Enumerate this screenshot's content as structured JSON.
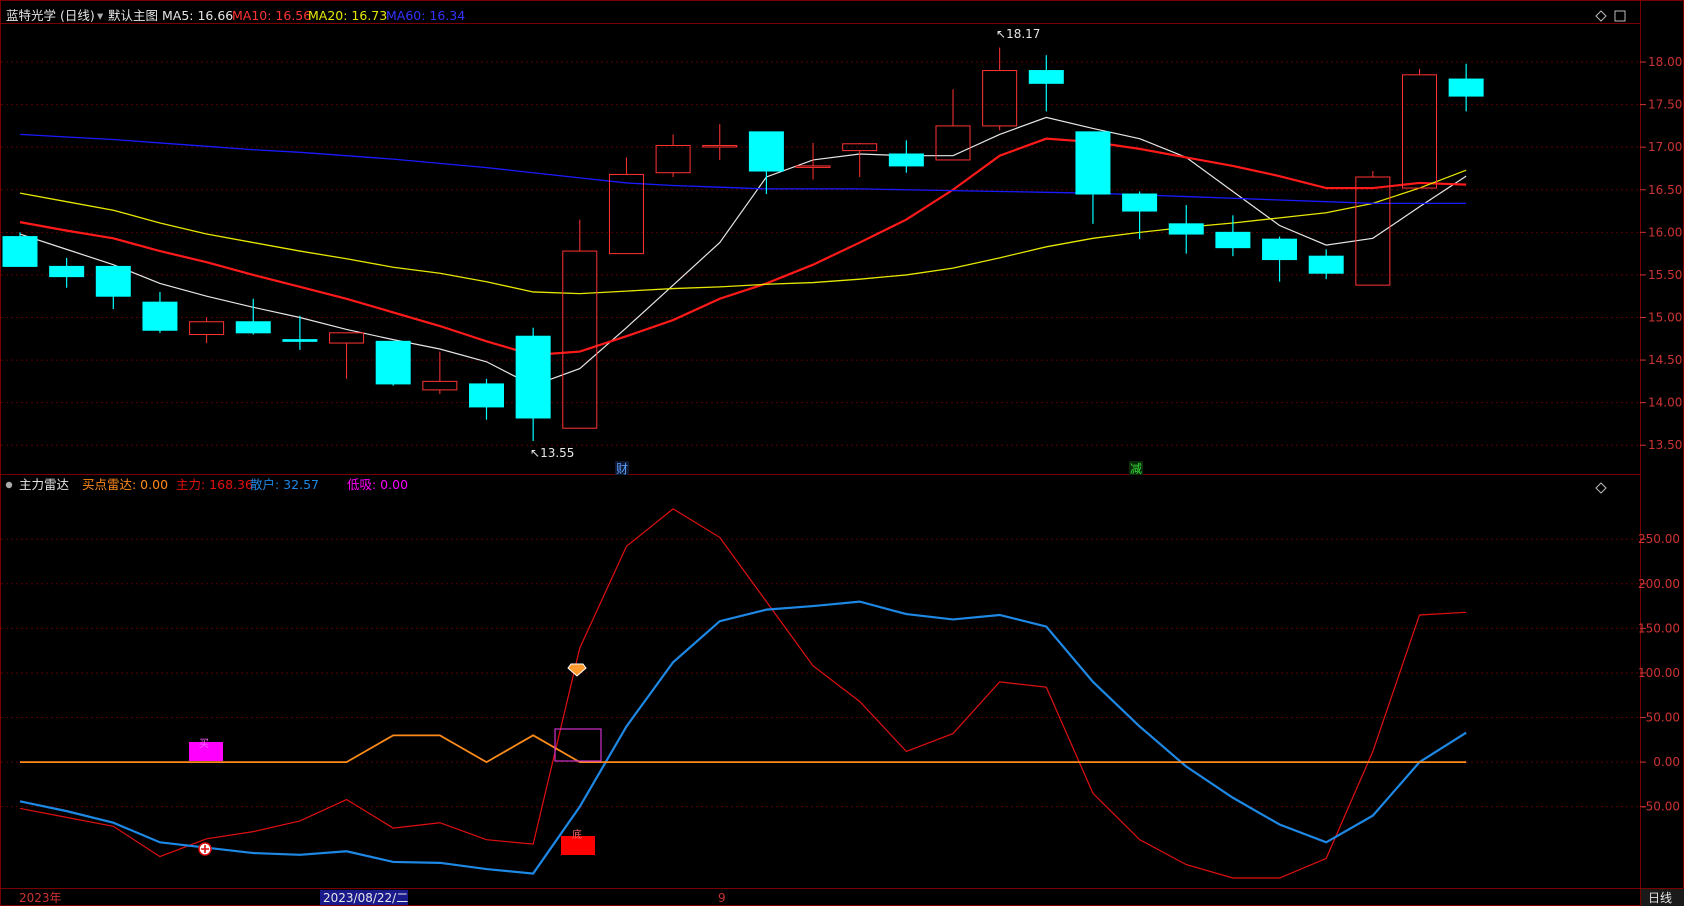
{
  "header": {
    "title": "蓝特光学 (日线)",
    "template": "默认主图",
    "ma5": "MA5: 16.66",
    "ma10": "MA10: 16.56",
    "ma20": "MA20: 16.73",
    "ma60": "MA60: 16.34"
  },
  "indicator_header": {
    "name": "主力雷达",
    "buy_radar": "买点雷达: 0.00",
    "main_force": "主力: 168.36",
    "retail": "散户: 32.57",
    "low_absorb": "低吸: 0.00"
  },
  "annotations": {
    "high": "18.17",
    "low": "13.55",
    "marker_cai": "财",
    "marker_jian": "减",
    "label_di": "底",
    "label_buy": "买"
  },
  "footer": {
    "year": "2023年",
    "date": "2023/08/22/二",
    "month": "9",
    "period_button": "日线"
  },
  "colors": {
    "up": "#ff3333",
    "down": "#00ffff",
    "ma5": "#e6e6e6",
    "ma10": "#ff1a1a",
    "ma20": "#e6e600",
    "ma60": "#1a1aff",
    "main_force": "#e01010",
    "retail": "#1e88e5",
    "buy_radar": "#ff8c1a",
    "low_absorb": "#ff00ff",
    "grid": "#5a0000"
  },
  "chart_data": [
    {
      "type": "candlestick",
      "title": "蓝特光学 (日线)",
      "ylim": [
        13.35,
        18.2
      ],
      "yticks": [
        "18.00",
        "17.50",
        "17.00",
        "16.50",
        "16.00",
        "15.50",
        "15.00",
        "14.50",
        "14.00",
        "13.50"
      ],
      "candles": [
        {
          "o": 15.95,
          "h": 16.0,
          "l": 15.6,
          "c": 15.6
        },
        {
          "o": 15.6,
          "h": 15.7,
          "l": 15.35,
          "c": 15.48
        },
        {
          "o": 15.6,
          "h": 15.6,
          "l": 15.1,
          "c": 15.25
        },
        {
          "o": 15.18,
          "h": 15.3,
          "l": 14.82,
          "c": 14.85
        },
        {
          "o": 14.8,
          "h": 15.0,
          "l": 14.7,
          "c": 14.95
        },
        {
          "o": 14.95,
          "h": 15.22,
          "l": 14.8,
          "c": 14.82
        },
        {
          "o": 14.74,
          "h": 15.02,
          "l": 14.62,
          "c": 14.72
        },
        {
          "o": 14.7,
          "h": 14.82,
          "l": 14.28,
          "c": 14.82
        },
        {
          "o": 14.72,
          "h": 14.72,
          "l": 14.2,
          "c": 14.22
        },
        {
          "o": 14.15,
          "h": 14.6,
          "l": 14.1,
          "c": 14.25
        },
        {
          "o": 14.22,
          "h": 14.28,
          "l": 13.8,
          "c": 13.95
        },
        {
          "o": 14.78,
          "h": 14.88,
          "l": 13.55,
          "c": 13.82
        },
        {
          "o": 13.7,
          "h": 16.15,
          "l": 13.7,
          "c": 15.78
        },
        {
          "o": 15.75,
          "h": 16.88,
          "l": 15.75,
          "c": 16.68
        },
        {
          "o": 16.7,
          "h": 17.15,
          "l": 16.65,
          "c": 17.02
        },
        {
          "o": 17.02,
          "h": 17.27,
          "l": 16.85,
          "c": 17.02
        },
        {
          "o": 17.18,
          "h": 17.18,
          "l": 16.45,
          "c": 16.72
        },
        {
          "o": 16.78,
          "h": 17.05,
          "l": 16.62,
          "c": 16.78
        },
        {
          "o": 16.96,
          "h": 17.05,
          "l": 16.65,
          "c": 17.04
        },
        {
          "o": 16.92,
          "h": 17.08,
          "l": 16.7,
          "c": 16.78
        },
        {
          "o": 16.85,
          "h": 17.68,
          "l": 16.85,
          "c": 17.25
        },
        {
          "o": 17.25,
          "h": 18.17,
          "l": 17.2,
          "c": 17.9
        },
        {
          "o": 17.9,
          "h": 18.08,
          "l": 17.42,
          "c": 17.75
        },
        {
          "o": 17.18,
          "h": 17.18,
          "l": 16.1,
          "c": 16.45
        },
        {
          "o": 16.45,
          "h": 16.48,
          "l": 15.92,
          "c": 16.25
        },
        {
          "o": 16.1,
          "h": 16.32,
          "l": 15.75,
          "c": 15.98
        },
        {
          "o": 16.0,
          "h": 16.2,
          "l": 15.72,
          "c": 15.82
        },
        {
          "o": 15.92,
          "h": 15.95,
          "l": 15.42,
          "c": 15.68
        },
        {
          "o": 15.72,
          "h": 15.8,
          "l": 15.45,
          "c": 15.52
        },
        {
          "o": 15.38,
          "h": 16.72,
          "l": 15.38,
          "c": 16.65
        },
        {
          "o": 16.52,
          "h": 17.92,
          "l": 16.52,
          "c": 17.85
        },
        {
          "o": 17.8,
          "h": 17.98,
          "l": 17.42,
          "c": 17.6
        }
      ],
      "series": [
        {
          "name": "MA5",
          "values": [
            15.98,
            15.8,
            15.62,
            15.4,
            15.25,
            15.12,
            15.0,
            14.86,
            14.74,
            14.63,
            14.48,
            14.2,
            14.4,
            14.88,
            15.38,
            15.88,
            16.65,
            16.85,
            16.92,
            16.9,
            16.9,
            17.15,
            17.35,
            17.22,
            17.1,
            16.88,
            16.48,
            16.08,
            15.85,
            15.93,
            16.3,
            16.66
          ]
        },
        {
          "name": "MA10",
          "values": [
            16.12,
            16.02,
            15.93,
            15.78,
            15.65,
            15.5,
            15.36,
            15.22,
            15.06,
            14.9,
            14.72,
            14.56,
            14.6,
            14.78,
            14.97,
            15.22,
            15.4,
            15.62,
            15.88,
            16.15,
            16.5,
            16.9,
            17.1,
            17.06,
            16.98,
            16.88,
            16.78,
            16.66,
            16.52,
            16.52,
            16.58,
            16.56
          ]
        },
        {
          "name": "MA20",
          "values": [
            16.46,
            16.36,
            16.26,
            16.11,
            15.98,
            15.88,
            15.78,
            15.69,
            15.59,
            15.52,
            15.42,
            15.3,
            15.28,
            15.31,
            15.34,
            15.36,
            15.39,
            15.41,
            15.45,
            15.5,
            15.58,
            15.7,
            15.83,
            15.93,
            16.0,
            16.06,
            16.11,
            16.17,
            16.23,
            16.34,
            16.52,
            16.73
          ]
        },
        {
          "name": "MA60",
          "values": [
            17.15,
            17.12,
            17.09,
            17.05,
            17.01,
            16.97,
            16.94,
            16.9,
            16.86,
            16.81,
            16.76,
            16.7,
            16.64,
            16.58,
            16.55,
            16.53,
            16.51,
            16.51,
            16.51,
            16.5,
            16.49,
            16.48,
            16.47,
            16.46,
            16.44,
            16.42,
            16.4,
            16.38,
            16.36,
            16.34,
            16.34,
            16.34
          ]
        }
      ]
    },
    {
      "type": "line",
      "title": "主力雷达",
      "ylim": [
        -130,
        285
      ],
      "yticks": [
        "250.00",
        "200.00",
        "150.00",
        "100.00",
        "50.00",
        "0.00",
        "-50.00"
      ],
      "series": [
        {
          "name": "主力",
          "values": [
            -52,
            -62,
            -72,
            -106,
            -86,
            -78,
            -66,
            -42,
            -74,
            -68,
            -87,
            -92,
            128,
            242,
            284,
            252,
            180,
            108,
            68,
            12,
            32,
            90,
            84,
            -35,
            -87,
            -115,
            -130,
            -130,
            -108,
            12,
            165,
            168
          ]
        },
        {
          "name": "散户",
          "values": [
            -44,
            -55,
            -68,
            -90,
            -96,
            -102,
            -104,
            -100,
            -112,
            -113,
            -120,
            -125,
            -50,
            40,
            112,
            158,
            171,
            175,
            180,
            166,
            160,
            165,
            152,
            90,
            40,
            -5,
            -40,
            -70,
            -90,
            -60,
            0,
            33
          ]
        },
        {
          "name": "买点雷达",
          "values": [
            0,
            0,
            0,
            0,
            0,
            0,
            0,
            0,
            30,
            30,
            0,
            30,
            0,
            0,
            0,
            0,
            0,
            0,
            0,
            0,
            0,
            0,
            0,
            0,
            0,
            0,
            0,
            0,
            0,
            0,
            0,
            0
          ]
        }
      ]
    }
  ]
}
